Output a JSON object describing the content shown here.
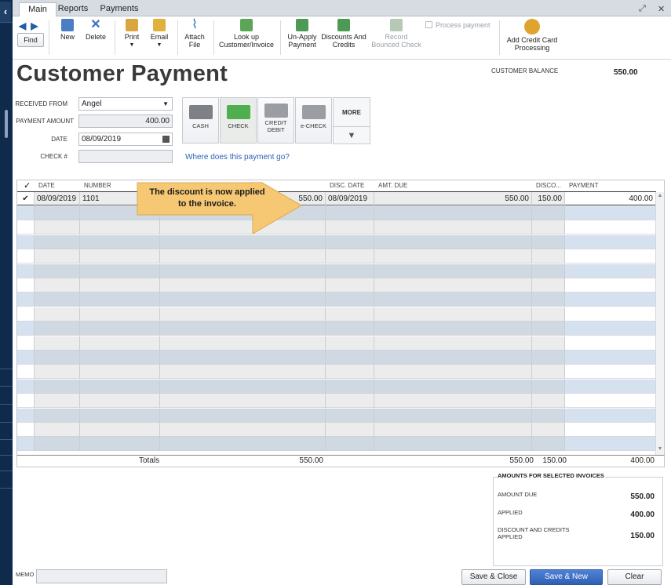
{
  "tabs": [
    "Main",
    "Reports",
    "Payments"
  ],
  "toolbar": {
    "find": "Find",
    "new": "New",
    "delete": "Delete",
    "print": "Print",
    "email": "Email",
    "attach_l1": "Attach",
    "attach_l2": "File",
    "lookup_l1": "Look up",
    "lookup_l2": "Customer/Invoice",
    "unapply_l1": "Un-Apply",
    "unapply_l2": "Payment",
    "discounts_l1": "Discounts And",
    "discounts_l2": "Credits",
    "record_l1": "Record",
    "record_l2": "Bounced Check",
    "process_payment": "Process payment",
    "addcc_l1": "Add Credit Card",
    "addcc_l2": "Processing"
  },
  "header": {
    "title": "Customer Payment",
    "customer_balance_label": "CUSTOMER BALANCE",
    "customer_balance_value": "550.00"
  },
  "form": {
    "received_from_label": "RECEIVED FROM",
    "received_from_value": "Angel",
    "payment_amount_label": "PAYMENT AMOUNT",
    "payment_amount_value": "400.00",
    "date_label": "DATE",
    "date_value": "08/09/2019",
    "check_label": "CHECK #",
    "check_value": ""
  },
  "payment_methods": {
    "cash": "CASH",
    "check": "CHECK",
    "credit_l1": "CREDIT",
    "credit_l2": "DEBIT",
    "echeck": "e-CHECK",
    "more": "MORE"
  },
  "where_link": "Where does this payment go?",
  "grid": {
    "headers": {
      "check": "✓",
      "date": "DATE",
      "number": "NUMBER",
      "disc_date": "DISC. DATE",
      "amt_due": "AMT. DUE",
      "disco": "DISCO...",
      "payment": "PAYMENT"
    },
    "row": {
      "check": "✔",
      "date": "08/09/2019",
      "number": "1101",
      "orig_amt": "550.00",
      "disc_date": "08/09/2019",
      "amt_due": "550.00",
      "disco": "150.00",
      "payment": "400.00"
    }
  },
  "totals": {
    "label": "Totals",
    "orig_amt": "550.00",
    "amt_due": "550.00",
    "disco": "150.00",
    "payment": "400.00"
  },
  "callout": {
    "line1": "The discount  is now applied",
    "line2": "to the invoice."
  },
  "summary": {
    "heading": "AMOUNTS FOR SELECTED INVOICES",
    "amount_due_label": "AMOUNT DUE",
    "amount_due_value": "550.00",
    "applied_label": "APPLIED",
    "applied_value": "400.00",
    "dc_label_l1": "DISCOUNT AND CREDITS",
    "dc_label_l2": "APPLIED",
    "dc_value": "150.00"
  },
  "footer": {
    "memo_label": "MEMO",
    "save_close": "Save & Close",
    "save_new": "Save & New",
    "clear": "Clear"
  },
  "colors": {
    "accent": "#2f5fb3",
    "row_stripe": "#d5e1ef",
    "callout": "#f7c873",
    "sidebar": "#0f2a4a"
  }
}
